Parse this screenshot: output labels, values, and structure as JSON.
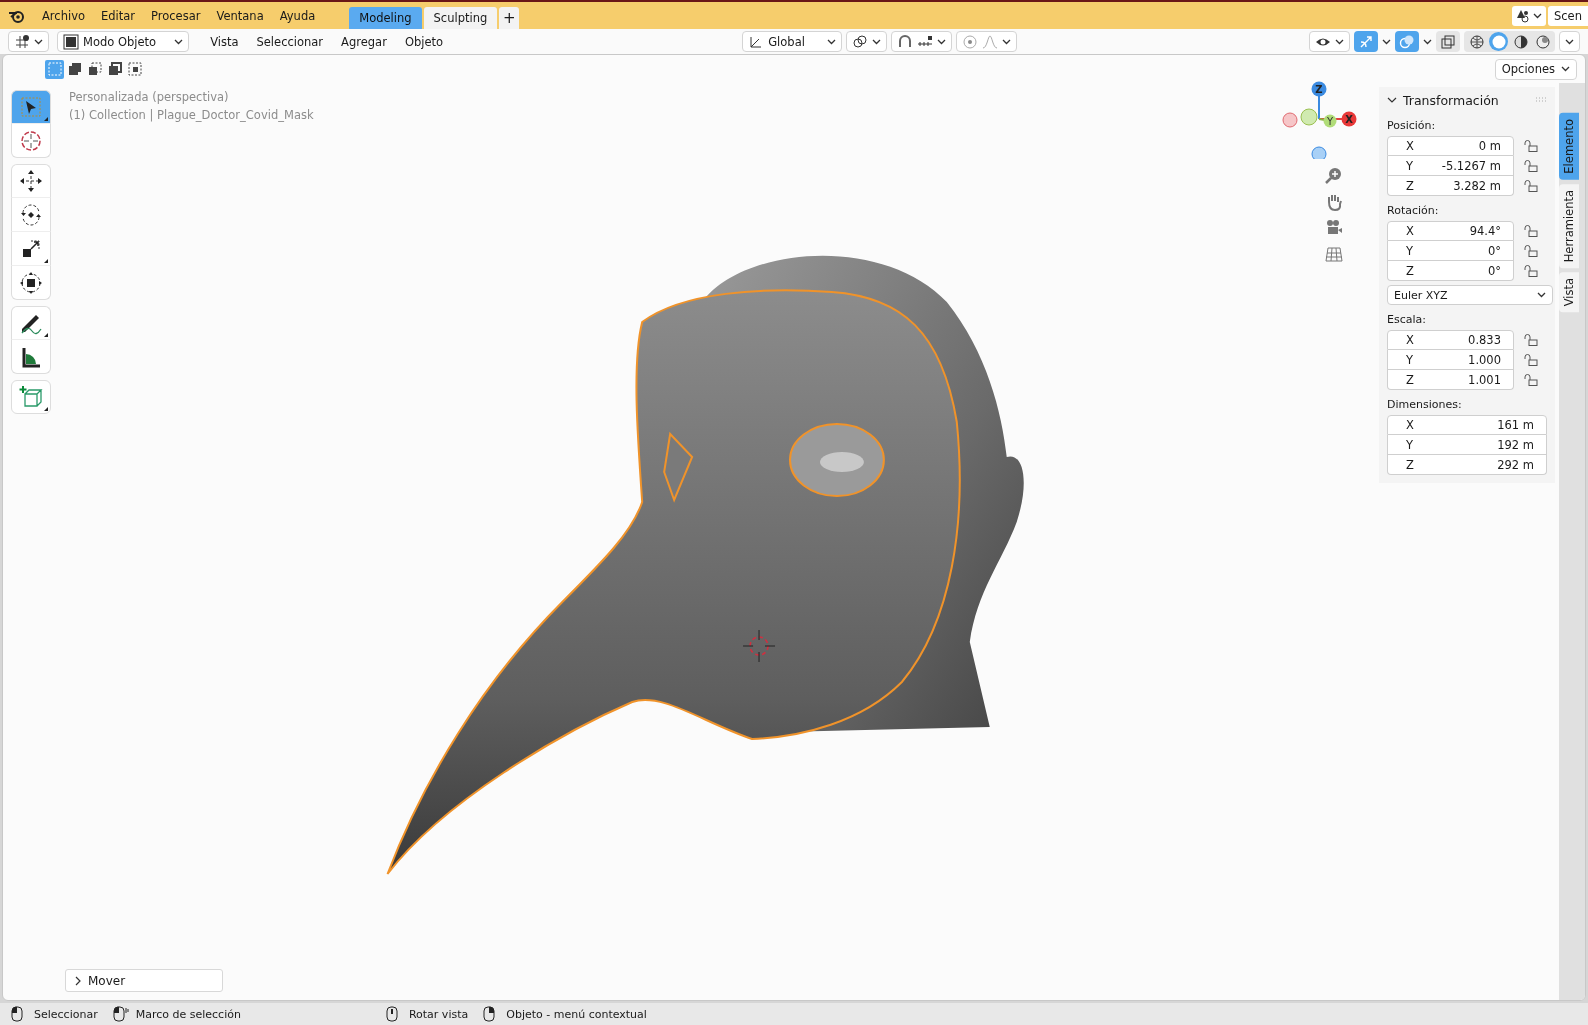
{
  "topbar": {
    "menus": [
      "Archivo",
      "Editar",
      "Procesar",
      "Ventana",
      "Ayuda"
    ],
    "workspaces": [
      {
        "label": "Modeling",
        "selected": true
      },
      {
        "label": "Sculpting",
        "selected": false
      }
    ],
    "add_tab": "+",
    "scene": "Scen"
  },
  "header": {
    "mode": "Modo Objeto",
    "menus": [
      "Vista",
      "Seleccionar",
      "Agregar",
      "Objeto"
    ],
    "orientation": "Global",
    "select_modes": [
      {
        "kind": "new",
        "selected": true
      },
      {
        "kind": "extend",
        "selected": false
      },
      {
        "kind": "subtract",
        "selected": false
      },
      {
        "kind": "difference",
        "selected": false
      },
      {
        "kind": "intersect",
        "selected": false
      }
    ],
    "shading_modes": [
      {
        "kind": "wireframe",
        "selected": false
      },
      {
        "kind": "solid",
        "selected": true
      },
      {
        "kind": "material",
        "selected": false
      },
      {
        "kind": "rendered",
        "selected": false
      }
    ],
    "options": "Opciones"
  },
  "toolbar": [
    {
      "kind": "select",
      "selected": true
    },
    {
      "kind": "cursor",
      "selected": false
    },
    {
      "kind": "move",
      "selected": false
    },
    {
      "kind": "rotate",
      "selected": false
    },
    {
      "kind": "scale",
      "selected": false
    },
    {
      "kind": "transform",
      "selected": false
    },
    {
      "kind": "annotate",
      "selected": false
    },
    {
      "kind": "measure",
      "selected": false
    },
    {
      "kind": "add-cube",
      "selected": false
    }
  ],
  "viewport": {
    "view_name": "Personalizada (perspectiva)",
    "collection": "(1) Collection | Plague_Doctor_Covid_Mask"
  },
  "gizmo": {
    "z": "Z",
    "y": "Y",
    "x": "X"
  },
  "panel": {
    "title": "Transformación",
    "expanded": true,
    "sections": [
      {
        "label": "Posición:",
        "rows": [
          {
            "axis": "X",
            "value": "0 m",
            "locked": false
          },
          {
            "axis": "Y",
            "value": "-5.1267 m",
            "locked": false
          },
          {
            "axis": "Z",
            "value": "3.282 m",
            "locked": false
          }
        ]
      },
      {
        "label": "Rotación:",
        "rows": [
          {
            "axis": "X",
            "value": "94.4°",
            "locked": false
          },
          {
            "axis": "Y",
            "value": "0°",
            "locked": false
          },
          {
            "axis": "Z",
            "value": "0°",
            "locked": false
          }
        ],
        "mode": "Euler XYZ"
      },
      {
        "label": "Escala:",
        "rows": [
          {
            "axis": "X",
            "value": "0.833",
            "locked": false
          },
          {
            "axis": "Y",
            "value": "1.000",
            "locked": false
          },
          {
            "axis": "Z",
            "value": "1.001",
            "locked": false
          }
        ]
      },
      {
        "label": "Dimensiones:",
        "rows": [
          {
            "axis": "X",
            "value": "161 m"
          },
          {
            "axis": "Y",
            "value": "192 m"
          },
          {
            "axis": "Z",
            "value": "292 m"
          }
        ]
      }
    ]
  },
  "side_tabs": [
    {
      "label": "Elemento",
      "selected": true
    },
    {
      "label": "Herramienta",
      "selected": false
    },
    {
      "label": "Vista",
      "selected": false
    }
  ],
  "last_operation": {
    "label": "Mover",
    "expanded": false
  },
  "status_bar": [
    {
      "label": "Seleccionar",
      "kind": "left"
    },
    {
      "label": "Marco de selección",
      "kind": "left-drag"
    },
    {
      "label": "Rotar vista",
      "kind": "middle"
    },
    {
      "label": "Objeto - menú contextual",
      "kind": "right"
    }
  ]
}
